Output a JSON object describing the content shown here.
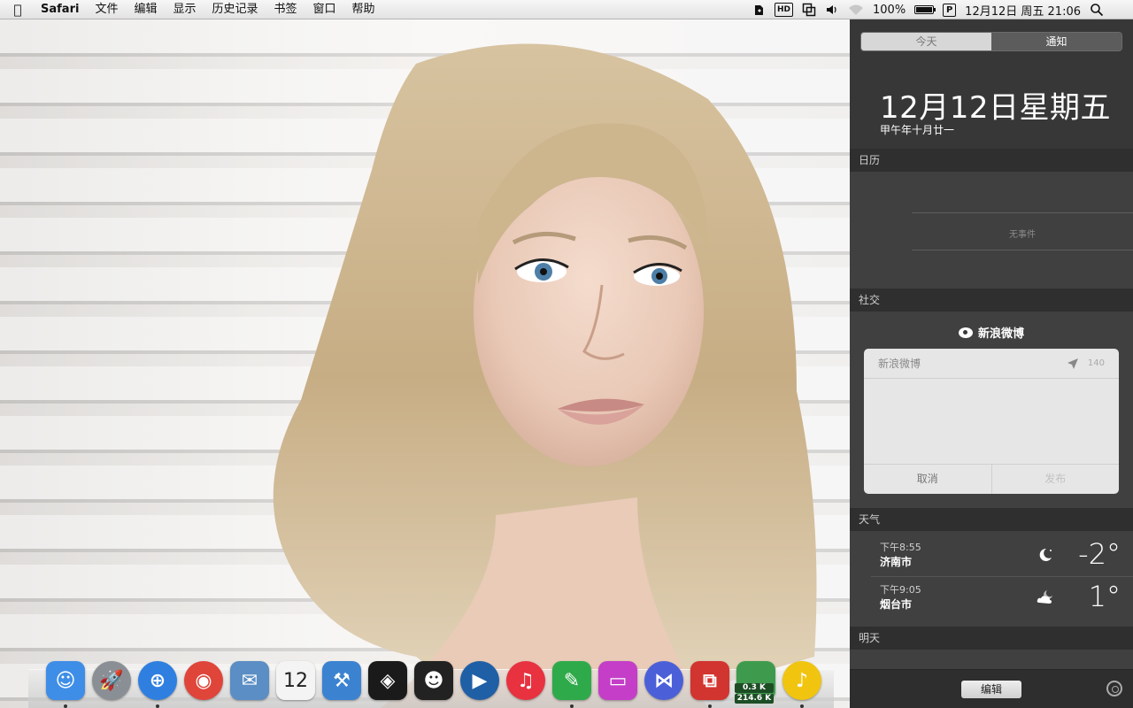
{
  "menubar": {
    "app_name": "Safari",
    "menus": [
      "文件",
      "编辑",
      "显示",
      "历史记录",
      "书签",
      "窗口",
      "帮助"
    ],
    "status": {
      "hd_label": "HD",
      "battery_percent": "100%",
      "battery_level": 1.0,
      "input_method": "P",
      "datetime": "12月12日 周五  21:06"
    }
  },
  "wallpaper": {
    "description_icon": "portrait-photo"
  },
  "dock": {
    "apps": [
      {
        "name": "finder-icon",
        "glyph": "☺",
        "color": "#3e8ee8",
        "running": true
      },
      {
        "name": "launchpad-icon",
        "glyph": "🚀",
        "color": "#8a8f96",
        "running": false
      },
      {
        "name": "safari-icon",
        "glyph": "⊕",
        "color": "#2f7fe0",
        "running": true
      },
      {
        "name": "chrome-icon",
        "glyph": "◉",
        "color": "#e0453a",
        "running": false
      },
      {
        "name": "mail-icon",
        "glyph": "✉",
        "color": "#5a8ec4",
        "running": false
      },
      {
        "name": "calendar-icon",
        "glyph": "12",
        "color": "#f4f4f4",
        "running": false
      },
      {
        "name": "xcode-icon",
        "glyph": "⚒",
        "color": "#3b83d1",
        "running": false
      },
      {
        "name": "unity-icon",
        "glyph": "◈",
        "color": "#1a1a1a",
        "running": false
      },
      {
        "name": "qq-icon",
        "glyph": "☻",
        "color": "#222222",
        "running": false
      },
      {
        "name": "quicktime-icon",
        "glyph": "▶",
        "color": "#1f5fa6",
        "running": false
      },
      {
        "name": "itunes-icon",
        "glyph": "♫",
        "color": "#e8323f",
        "running": false
      },
      {
        "name": "evernote-icon",
        "glyph": "✎",
        "color": "#2faa4a",
        "running": true
      },
      {
        "name": "imac-icon",
        "glyph": "▭",
        "color": "#c43ec8",
        "running": false
      },
      {
        "name": "mweb-icon",
        "glyph": "⋈",
        "color": "#4b60d8",
        "running": false
      },
      {
        "name": "parallels-icon",
        "glyph": "⧉",
        "color": "#d2342f",
        "running": true
      },
      {
        "name": "netspeed-icon",
        "glyph": "",
        "color": "#3e9b4d",
        "running": false,
        "speeds": [
          "0.3 K",
          "214.6 K"
        ]
      },
      {
        "name": "qqmusic-icon",
        "glyph": "♪",
        "color": "#f1c40f",
        "running": true
      }
    ]
  },
  "notification_center": {
    "tabs": {
      "today": "今天",
      "notifications": "通知"
    },
    "date": "12月12日星期五",
    "lunar": "甲午年十月廿一",
    "calendar": {
      "header": "日历",
      "empty": "无事件"
    },
    "social": {
      "header": "社交",
      "service": "新浪微博",
      "compose_account": "新浪微博",
      "char_count": "140",
      "cancel": "取消",
      "post": "发布"
    },
    "weather": {
      "header": "天气",
      "rows": [
        {
          "time": "下午8:55",
          "city": "济南市",
          "temp": "-2°",
          "icon": "moon-icon"
        },
        {
          "time": "下午9:05",
          "city": "烟台市",
          "temp": "1°",
          "icon": "cloud-moon-icon"
        }
      ]
    },
    "tomorrow": {
      "header": "明天"
    },
    "edit": "编辑"
  }
}
